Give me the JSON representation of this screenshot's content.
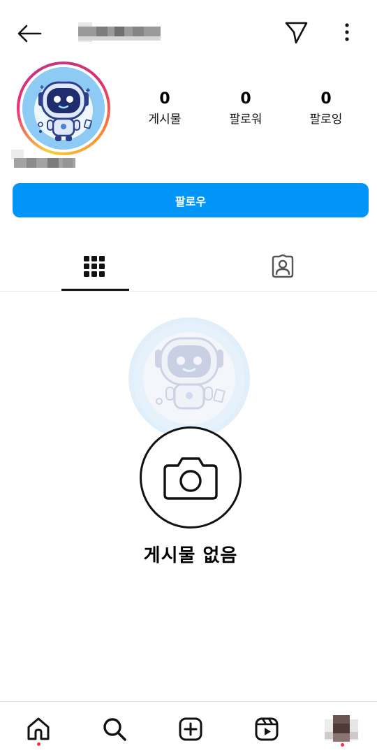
{
  "header": {
    "back_icon": "arrow-left-icon",
    "send_icon": "paper-plane-icon",
    "more_icon": "more-vertical-icon"
  },
  "profile": {
    "avatar_icon": "robot-astronaut-avatar",
    "stats": [
      {
        "value": "0",
        "label": "게시물"
      },
      {
        "value": "0",
        "label": "팔로워"
      },
      {
        "value": "0",
        "label": "팔로잉"
      }
    ],
    "follow_label": "팔로우"
  },
  "tabs": [
    {
      "icon": "grid-icon",
      "active": true
    },
    {
      "icon": "tagged-person-icon",
      "active": false
    }
  ],
  "empty_state": {
    "camera_icon": "camera-icon",
    "text": "게시물 없음"
  },
  "bottom_nav": [
    {
      "icon": "home-icon"
    },
    {
      "icon": "search-icon"
    },
    {
      "icon": "create-icon"
    },
    {
      "icon": "reels-icon"
    },
    {
      "icon": "profile-avatar"
    }
  ],
  "colors": {
    "accent": "#0095f6",
    "notification": "#ff3040"
  }
}
